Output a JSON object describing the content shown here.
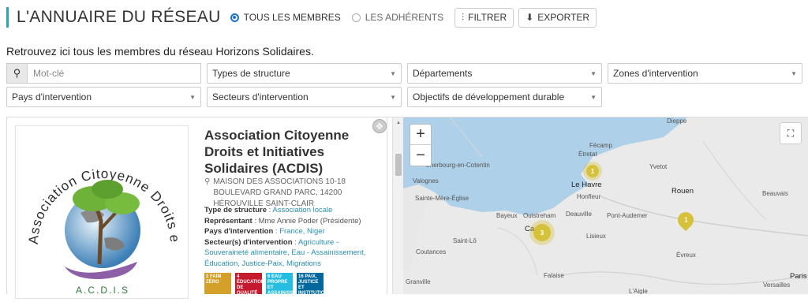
{
  "header": {
    "title": "L'ANNUAIRE DU RÉSEAU",
    "radio_all": "TOUS LES MEMBRES",
    "radio_members": "LES ADHÉRENTS",
    "filter_label": "FILTRER",
    "export_label": "EXPORTER",
    "accent_color": "#2aa5b0"
  },
  "intro": "Retrouvez ici tous les membres du réseau Horizons Solidaires.",
  "filters": {
    "search_placeholder": "Mot-clé",
    "structure_types": "Types de structure",
    "departments": "Départements",
    "zones": "Zones d'intervention",
    "countries": "Pays d'intervention",
    "sectors": "Secteurs d'intervention",
    "sdg": "Objectifs de développement durable"
  },
  "card": {
    "title": "Association Citoyenne Droits et Initiatives Solidaires (ACDIS)",
    "address": "MAISON DES ASSOCIATIONS 10-18 BOULEVARD GRAND PARC, 14200 HÉROUVILLE SAINT-CLAIR",
    "type_label": "Type de structure",
    "type_value": "Association locale",
    "rep_label": "Représentant",
    "rep_value": "Mme Annie Poder (Présidente)",
    "countries_label": "Pays d'intervention",
    "countries_value": "France, Niger",
    "sectors_label": "Secteur(s) d'intervention",
    "sectors_value": "Agriculture - Souveraineté alimentaire, Eau - Assainissement, Éducation, Justice-Paix, Migrations",
    "logo_arc_text": "Association Citoyenne Droits et Initiatives Solidaires",
    "logo_caption": "A.C.D.I.S",
    "sdgs": [
      {
        "num": "2",
        "text": "FAIM ZÉRO",
        "color": "#d3a029"
      },
      {
        "num": "4",
        "text": "ÉDUCATION DE QUALITÉ",
        "color": "#c5192d"
      },
      {
        "num": "6",
        "text": "EAU PROPRE ET ASSAINISSEMENT",
        "color": "#26bde2"
      },
      {
        "num": "16",
        "text": "PAIX, JUSTICE ET INSTITUTIONS EFFICACES",
        "color": "#00689d"
      }
    ]
  },
  "map": {
    "zoom_in": "+",
    "zoom_out": "−",
    "places": {
      "dieppe": "Dieppe",
      "fecamp": "Fécamp",
      "etretat": "Étretat",
      "yvetot": "Yvetot",
      "cherbourg": "Cherbourg-en-Cotentin",
      "valognes": "Valognes",
      "le_havre": "Le Havre",
      "honfleur": "Honfleur",
      "rouen": "Rouen",
      "beauvais": "Beauvais",
      "sainte_mere": "Sainte-Mère-Église",
      "bayeux": "Bayeux",
      "ouistreham": "Ouistreham",
      "deauville": "Deauville",
      "pont_audemer": "Pont-Audemer",
      "caen": "Caen",
      "lisieux": "Lisieux",
      "saint_lo": "Saint-Lô",
      "evreux": "Évreux",
      "coutances": "Coutances",
      "falaise": "Falaise",
      "granville": "Granville",
      "paris": "Paris",
      "versailles": "Versailles",
      "laigle": "L'Aigle"
    },
    "clusters": {
      "le_havre": "1",
      "caen": "3",
      "rouen": "1"
    }
  }
}
